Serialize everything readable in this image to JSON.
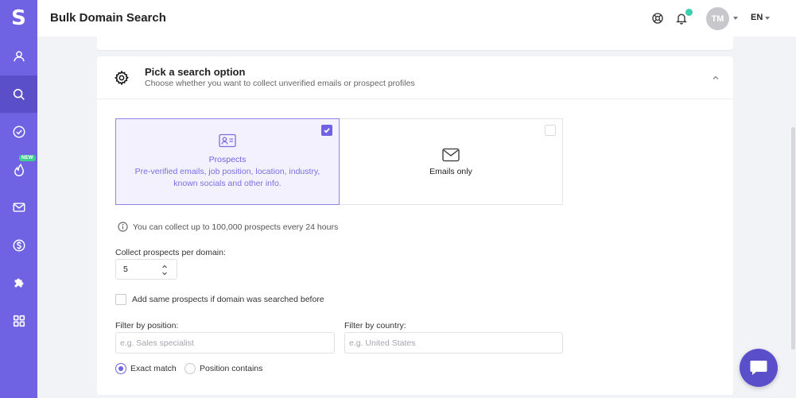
{
  "app": {
    "logo_letter": "S"
  },
  "header": {
    "title": "Bulk Domain Search",
    "avatar_initials": "TM",
    "language": "EN"
  },
  "sidebar": {
    "items": [
      {
        "icon": "user-icon"
      },
      {
        "icon": "search-icon",
        "active": true
      },
      {
        "icon": "check-circle-icon"
      },
      {
        "icon": "flame-icon",
        "badge": "NEW"
      },
      {
        "icon": "mail-icon"
      },
      {
        "icon": "dollar-icon"
      },
      {
        "icon": "puzzle-icon"
      },
      {
        "icon": "grid-icon"
      }
    ]
  },
  "section": {
    "title": "Pick a search option",
    "subtitle": "Choose whether you want to collect unverified emails or prospect profiles"
  },
  "options": {
    "prospects": {
      "title": "Prospects",
      "description": "Pre-verified emails, job position, location, industry, known socials and other info.",
      "selected": true
    },
    "emails": {
      "title": "Emails only",
      "selected": false
    }
  },
  "info_text": "You can collect up to 100,000 prospects every 24 hours",
  "collect": {
    "label": "Collect prospects per domain:",
    "value": "5"
  },
  "add_same": {
    "label": "Add same prospects if domain was searched before",
    "checked": false
  },
  "filters": {
    "position_label": "Filter by position:",
    "position_placeholder": "e.g. Sales specialist",
    "country_label": "Filter by country:",
    "country_placeholder": "e.g. United States"
  },
  "match": {
    "exact_label": "Exact match",
    "contains_label": "Position contains",
    "selected": "exact"
  },
  "colors": {
    "sidebar": "#6f63e3",
    "sidebar_active": "#5a4ec9",
    "accent": "#6f63e3",
    "notification": "#3ecfb0",
    "badge_new": "#3ecf8e"
  }
}
